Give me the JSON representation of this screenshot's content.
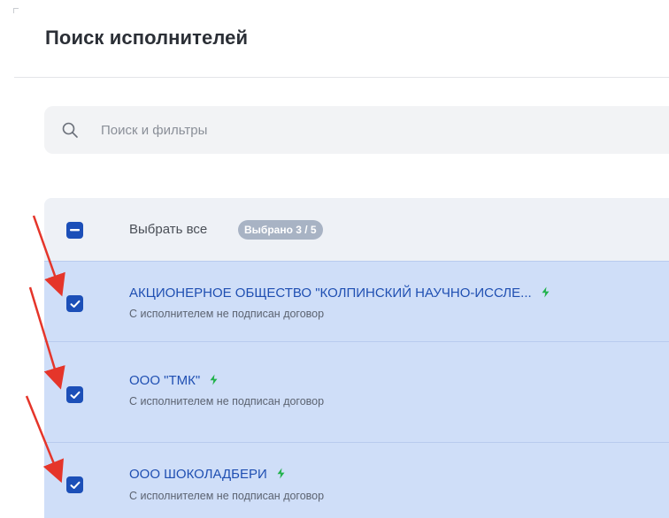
{
  "page": {
    "title": "Поиск исполнителей"
  },
  "search": {
    "placeholder": "Поиск и фильтры"
  },
  "select_all": {
    "label": "Выбрать все",
    "badge": "Выбрано 3 / 5"
  },
  "rows": [
    {
      "title": "АКЦИОНЕРНОЕ ОБЩЕСТВО \"КОЛПИНСКИЙ НАУЧНО-ИССЛЕ...",
      "subtitle": "С исполнителем не подписан договор",
      "checked": true
    },
    {
      "title": "ООО \"ТМК\"",
      "subtitle": "С исполнителем не подписан договор",
      "checked": true
    },
    {
      "title": "ООО ШОКОЛАДБЕРИ",
      "subtitle": "С исполнителем не подписан договор",
      "checked": true
    }
  ],
  "colors": {
    "accent": "#1c4fb8",
    "selected_row": "#cfdef8",
    "bolt": "#22b24c",
    "annotation_arrow": "#e5352a"
  },
  "icons": [
    "search-icon",
    "minus-icon",
    "check-icon",
    "bolt-icon",
    "red-arrow"
  ]
}
